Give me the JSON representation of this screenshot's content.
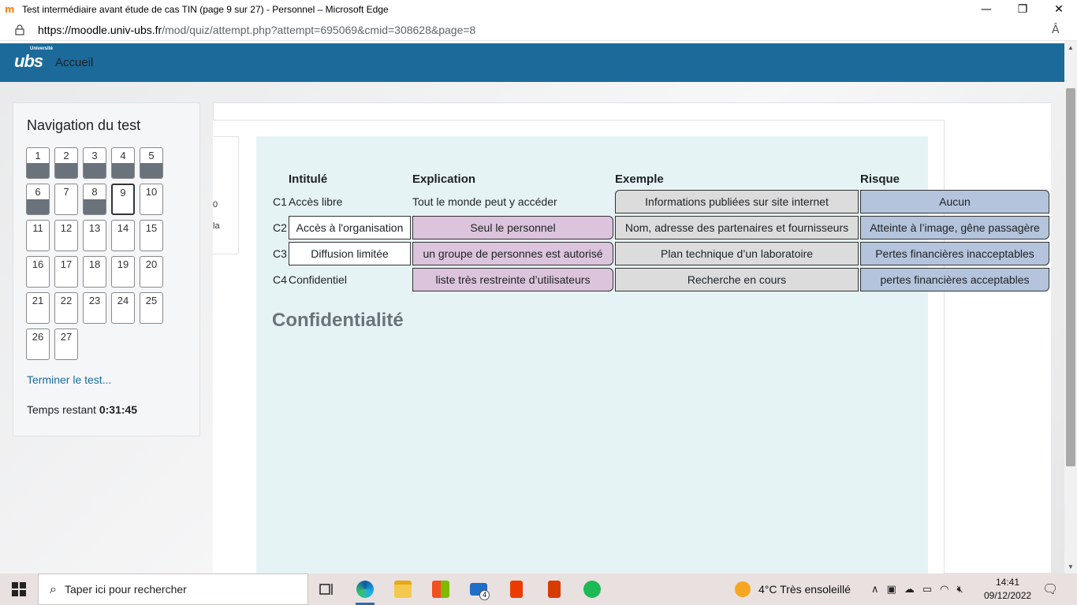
{
  "window": {
    "title": "Test intermédiaire avant étude de cas TIN (page 9 sur 27) - Personnel – Microsoft Edge",
    "favicon": "m",
    "minimize": "—",
    "restore": "❐",
    "close": "✕"
  },
  "address": {
    "url_host": "https://moodle.univ-ubs.fr",
    "url_path": "/mod/quiz/attempt.php?attempt=695069&cmid=308628&page=8",
    "read_aloud": "Â"
  },
  "header": {
    "logo_text": "ubs",
    "logo_small": "Université",
    "home": "Accueil"
  },
  "nav": {
    "title": "Navigation du test",
    "questions": [
      {
        "n": "1",
        "state": "answered"
      },
      {
        "n": "2",
        "state": "answered"
      },
      {
        "n": "3",
        "state": "answered"
      },
      {
        "n": "4",
        "state": "answered"
      },
      {
        "n": "5",
        "state": "answered"
      },
      {
        "n": "6",
        "state": "answered"
      },
      {
        "n": "7",
        "state": "empty"
      },
      {
        "n": "8",
        "state": "answered"
      },
      {
        "n": "9",
        "state": "current"
      },
      {
        "n": "10",
        "state": "empty"
      },
      {
        "n": "11",
        "state": "empty"
      },
      {
        "n": "12",
        "state": "empty"
      },
      {
        "n": "13",
        "state": "empty"
      },
      {
        "n": "14",
        "state": "empty"
      },
      {
        "n": "15",
        "state": "empty"
      },
      {
        "n": "16",
        "state": "empty"
      },
      {
        "n": "17",
        "state": "empty"
      },
      {
        "n": "18",
        "state": "empty"
      },
      {
        "n": "19",
        "state": "empty"
      },
      {
        "n": "20",
        "state": "empty"
      },
      {
        "n": "21",
        "state": "empty"
      },
      {
        "n": "22",
        "state": "empty"
      },
      {
        "n": "23",
        "state": "empty"
      },
      {
        "n": "24",
        "state": "empty"
      },
      {
        "n": "25",
        "state": "empty"
      },
      {
        "n": "26",
        "state": "empty"
      },
      {
        "n": "27",
        "state": "empty"
      }
    ],
    "finish": "Terminer le test...",
    "timer_label": "Temps restant",
    "timer_value": "0:31:45"
  },
  "info_stub": {
    "line1": "0",
    "line2": "la"
  },
  "question": {
    "headers": {
      "intitule": "Intitulé",
      "explication": "Explication",
      "exemple": "Exemple",
      "risque": "Risque"
    },
    "rows": [
      {
        "code": "C1",
        "intitule": "Accès libre",
        "explication": "Tout le monde peut y accéder",
        "exemple": "Informations publiées sur site internet",
        "risque": "Aucun"
      },
      {
        "code": "C2",
        "intitule": "Accès à l'organisation",
        "explication": "Seul le personnel",
        "exemple": "Nom, adresse des partenaires et fournisseurs",
        "risque": "Atteinte à l’image, gêne passagère"
      },
      {
        "code": "C3",
        "intitule": "Diffusion limitée",
        "explication": "un groupe de personnes est autorisé",
        "exemple": "Plan technique d’un laboratoire",
        "risque": "Pertes financières inacceptables"
      },
      {
        "code": "C4",
        "intitule": "Confidentiel",
        "explication": "liste très restreinte d’utilisateurs",
        "exemple": "Recherche en cours",
        "risque": "pertes financières acceptables"
      }
    ],
    "drag_label": "Confidentialité"
  },
  "taskbar": {
    "search_placeholder": "Taper ici pour rechercher",
    "mail_badge": "4",
    "weather": "4°C  Très ensoleillé",
    "time": "14:41",
    "date": "09/12/2022"
  }
}
